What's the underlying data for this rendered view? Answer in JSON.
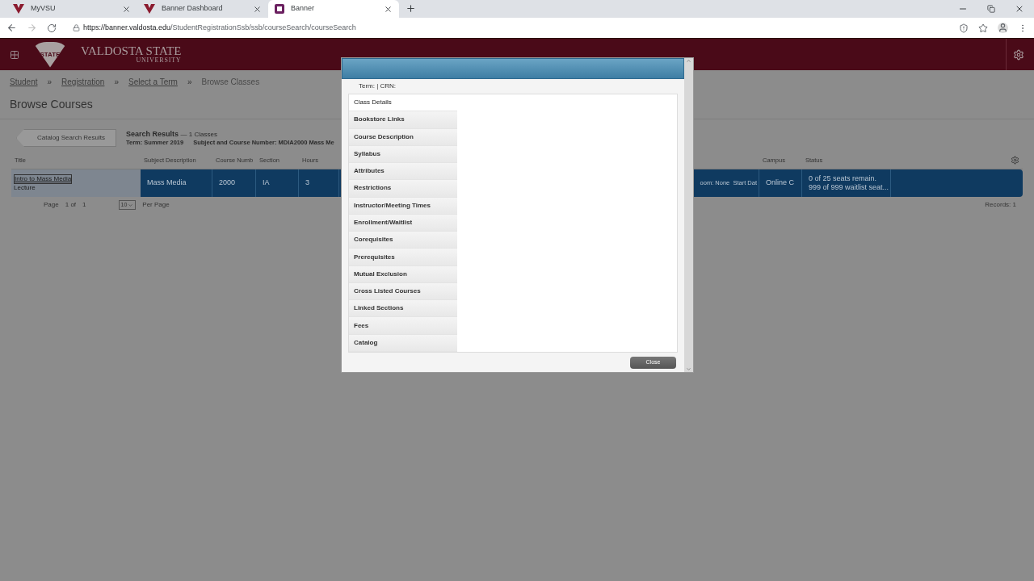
{
  "browser": {
    "tabs": [
      {
        "title": "MyVSU",
        "selected": false
      },
      {
        "title": "Banner Dashboard",
        "selected": false
      },
      {
        "title": "Banner",
        "selected": true
      }
    ],
    "url_host": "https://banner.valdosta.edu",
    "url_path": "/StudentRegistrationSsb/ssb/courseSearch/courseSearch"
  },
  "header": {
    "logo_badge": "STATE",
    "logo_name": "VALDOSTA STATE",
    "logo_sub": "UNIVERSITY"
  },
  "breadcrumbs": {
    "separator": "»",
    "items": [
      {
        "label": "Student",
        "link": true
      },
      {
        "label": "Registration",
        "link": true
      },
      {
        "label": "Select a Term",
        "link": true
      },
      {
        "label": "Browse Classes",
        "link": false
      }
    ]
  },
  "page_title": "Browse Courses",
  "back_button": "Catalog Search Results",
  "results": {
    "title": "Search Results",
    "count": "— 1 Classes",
    "term": "Term: Summer 2019",
    "subject": "Subject and Course Number: MDIA2000 Mass Me"
  },
  "table": {
    "columns": [
      "Title",
      "Subject Description",
      "Course Numb",
      "Section",
      "Hours",
      "Campus",
      "Status"
    ],
    "rows": [
      {
        "title": "Intro to Mass Media",
        "type": "Lecture",
        "subject": "Mass Media",
        "number": "2000",
        "section": "IA",
        "hours": "3",
        "meeting": "oom: None  Start Dat",
        "campus": "Online C",
        "status_1": "0 of 25 seats remain.",
        "status_2": "999 of 999 waitlist seat..."
      }
    ]
  },
  "pager": {
    "page": "Page",
    "current": "1",
    "of": "of",
    "total": "1",
    "per_page_value": "10",
    "per_page": "Per Page",
    "records": "Records: 1"
  },
  "dialog": {
    "subtitle": "Term: | CRN:",
    "tabs": [
      {
        "label": "Class Details",
        "selected": true
      },
      {
        "label": "Bookstore Links",
        "selected": false
      },
      {
        "label": "Course Description",
        "selected": false
      },
      {
        "label": "Syllabus",
        "selected": false
      },
      {
        "label": "Attributes",
        "selected": false
      },
      {
        "label": "Restrictions",
        "selected": false
      },
      {
        "label": "Instructor/Meeting Times",
        "selected": false
      },
      {
        "label": "Enrollment/Waitlist",
        "selected": false
      },
      {
        "label": "Corequisites",
        "selected": false
      },
      {
        "label": "Prerequisites",
        "selected": false
      },
      {
        "label": "Mutual Exclusion",
        "selected": false
      },
      {
        "label": "Cross Listed Courses",
        "selected": false
      },
      {
        "label": "Linked Sections",
        "selected": false
      },
      {
        "label": "Fees",
        "selected": false
      },
      {
        "label": "Catalog",
        "selected": false
      }
    ],
    "close": "Close"
  }
}
